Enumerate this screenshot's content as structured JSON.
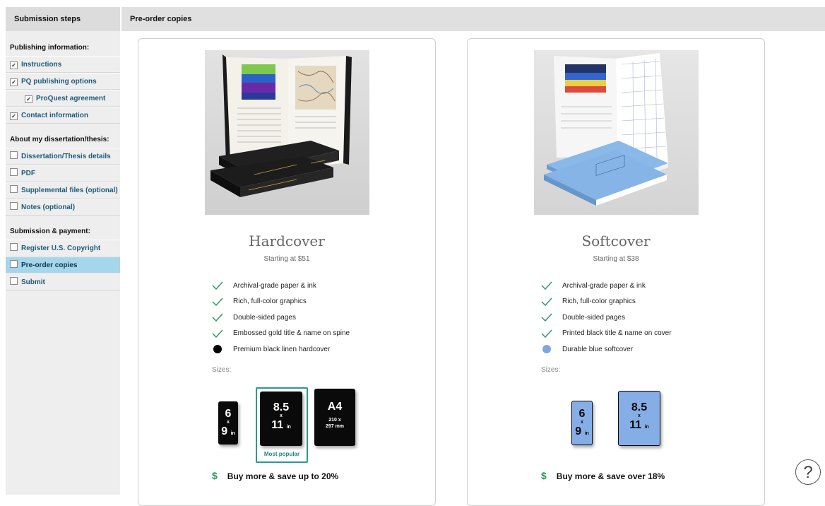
{
  "sidebar": {
    "header": "Submission steps",
    "sections": [
      {
        "title": "Publishing information:",
        "items": [
          {
            "label": "Instructions",
            "checked": true
          },
          {
            "label": "PQ publishing options",
            "checked": true
          },
          {
            "label": "ProQuest agreement",
            "checked": true,
            "sub": true
          },
          {
            "label": "Contact information",
            "checked": true
          }
        ]
      },
      {
        "title": "About my dissertation/thesis:",
        "items": [
          {
            "label": "Dissertation/Thesis details",
            "checked": false
          },
          {
            "label": "PDF",
            "checked": false
          },
          {
            "label": "Supplemental files (optional)",
            "checked": false
          },
          {
            "label": "Notes (optional)",
            "checked": false
          }
        ]
      },
      {
        "title": "Submission & payment:",
        "items": [
          {
            "label": "Register U.S. Copyright",
            "checked": false
          },
          {
            "label": "Pre-order copies",
            "checked": false,
            "active": true
          },
          {
            "label": "Submit",
            "checked": false
          }
        ]
      }
    ]
  },
  "page": {
    "title": "Pre-order copies"
  },
  "cards": {
    "hardcover": {
      "title": "Hardcover",
      "price": "Starting at $51",
      "features": [
        "Archival-grade paper & ink",
        "Rich, full-color graphics",
        "Double-sided pages",
        "Embossed gold title & name on spine"
      ],
      "finish": "Premium black linen hardcover",
      "finish_color": "#000000",
      "sizes_label": "Sizes:",
      "sizes": {
        "s6": {
          "top": "6",
          "x": "x",
          "bottom": "9",
          "unit": "in"
        },
        "s85": {
          "top": "8.5",
          "x": "x",
          "bottom": "11",
          "unit": "in"
        },
        "a4": {
          "top": "A4",
          "line1": "210 x",
          "line2": "297 mm"
        }
      },
      "popular_label": "Most popular",
      "save_symbol": "$",
      "save_text": "Buy more & save up to 20%"
    },
    "softcover": {
      "title": "Softcover",
      "price": "Starting at $38",
      "features": [
        "Archival-grade paper & ink",
        "Rich, full-color graphics",
        "Double-sided pages",
        "Printed black title & name on cover"
      ],
      "finish": "Durable blue softcover",
      "finish_color": "#7fa7df",
      "sizes_label": "Sizes:",
      "sizes": {
        "s6": {
          "top": "6",
          "x": "x",
          "bottom": "9",
          "unit": "in"
        },
        "s85": {
          "top": "8.5",
          "x": "x",
          "bottom": "11",
          "unit": "in"
        }
      },
      "save_symbol": "$",
      "save_text": "Buy more & save over 18%"
    }
  },
  "help_icon": "?",
  "colors": {
    "accent": "#2a9a8e",
    "check": "#2e9a6a",
    "active_step": "#a6d6ea",
    "link": "#1e5a7a"
  }
}
